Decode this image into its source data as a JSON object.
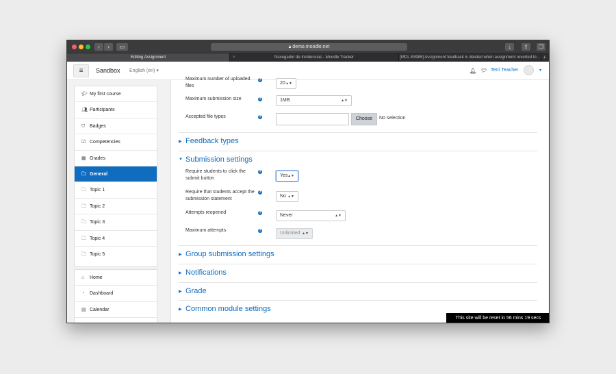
{
  "browser": {
    "url": "demo.moodle.net",
    "tabs": [
      {
        "label": "Editing Assignment",
        "active": true
      },
      {
        "label": "Navegador de Incidencias - Moodle Tracker",
        "active": false
      },
      {
        "label": "[MDL-53985] Assignment feedback is deleted when assignment reverted to...",
        "active": false
      }
    ]
  },
  "navbar": {
    "site_name": "Sandbox",
    "language": "English (en)",
    "user_name": "Terri Teacher"
  },
  "sidebar": {
    "items": [
      {
        "label": "My first course",
        "icon": "graduation-cap-icon"
      },
      {
        "label": "Participants",
        "icon": "users-icon"
      },
      {
        "label": "Badges",
        "icon": "shield-icon"
      },
      {
        "label": "Competencies",
        "icon": "checkbox-icon"
      },
      {
        "label": "Grades",
        "icon": "table-icon"
      },
      {
        "label": "General",
        "icon": "folder-icon",
        "active": true
      },
      {
        "label": "Topic 1",
        "icon": "folder-icon"
      },
      {
        "label": "Topic 2",
        "icon": "folder-icon"
      },
      {
        "label": "Topic 3",
        "icon": "folder-icon"
      },
      {
        "label": "Topic 4",
        "icon": "folder-icon"
      },
      {
        "label": "Topic 5",
        "icon": "folder-icon"
      }
    ],
    "items2": [
      {
        "label": "Home",
        "icon": "home-icon"
      },
      {
        "label": "Dashboard",
        "icon": "dashboard-icon"
      },
      {
        "label": "Calendar",
        "icon": "calendar-icon"
      }
    ]
  },
  "form": {
    "max_files_label": "Maximum number of uploaded files",
    "max_files_value": "20",
    "max_size_label": "Maximum submission size",
    "max_size_value": "1MB",
    "file_types_label": "Accepted file types",
    "choose_label": "Choose",
    "no_selection": "No selection",
    "feedback_types": "Feedback types",
    "submission_settings": "Submission settings",
    "require_click_label": "Require students to click the submit button",
    "require_click_value": "Yes",
    "require_accept_label": "Require that students accept the submission statement",
    "require_accept_value": "No",
    "attempts_reopened_label": "Attempts reopened",
    "attempts_reopened_value": "Never",
    "max_attempts_label": "Maximum attempts",
    "max_attempts_value": "Unlimited",
    "group_submission": "Group submission settings",
    "notifications": "Notifications",
    "grade": "Grade",
    "common_module": "Common module settings"
  },
  "reset_notice": "This site will be reset in 56 mins 19 secs",
  "colors": {
    "accent": "#0f6cbf",
    "active_sidebar": "#0f6cbf"
  }
}
